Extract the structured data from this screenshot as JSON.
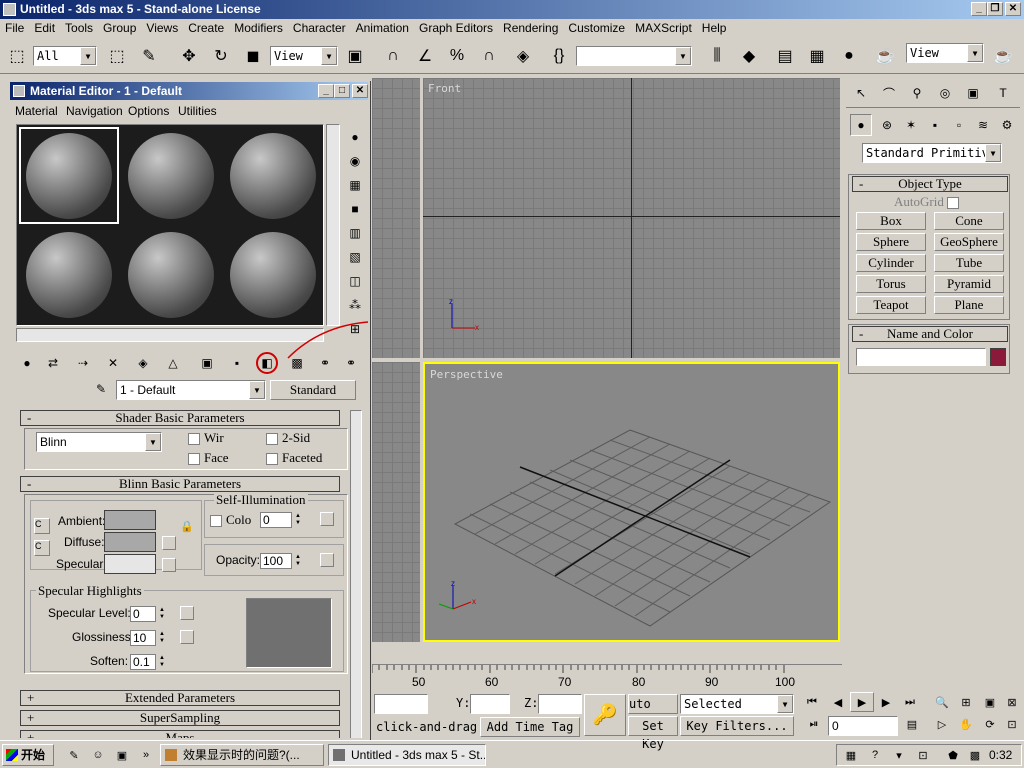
{
  "window": {
    "title": "Untitled - 3ds max 5 - Stand-alone License"
  },
  "menu": [
    "File",
    "Edit",
    "Tools",
    "Group",
    "Views",
    "Create",
    "Modifiers",
    "Character",
    "Animation",
    "Graph Editors",
    "Rendering",
    "Customize",
    "MAXScript",
    "Help"
  ],
  "toolbar": {
    "selection_filter": "All",
    "ref_coord": "View",
    "ref_coord2": "View"
  },
  "viewports": {
    "top_right": "Front",
    "bottom_right": "Perspective"
  },
  "material_editor": {
    "title": "Material Editor - 1 - Default",
    "menu": [
      "Material",
      "Navigation",
      "Options",
      "Utilities"
    ],
    "material_name": "1 - Default",
    "material_type": "Standard",
    "shader_rollout": "Shader Basic Parameters",
    "shader_type": "Blinn",
    "shader_options": {
      "wire": "Wir",
      "two_sided": "2-Sid",
      "face": "Face",
      "faceted": "Faceted"
    },
    "blinn_rollout": "Blinn Basic Parameters",
    "self_illum": {
      "title": "Self-Illumination",
      "color_label": "Colo",
      "value": "0"
    },
    "ambient_label": "Ambient:",
    "diffuse_label": "Diffuse:",
    "specular_label": "Specular:",
    "opacity_label": "Opacity:",
    "opacity_value": "100",
    "specular_highlights": {
      "title": "Specular Highlights",
      "level_label": "Specular Level:",
      "level": "0",
      "gloss_label": "Glossiness:",
      "gloss": "10",
      "soften_label": "Soften:",
      "soften": "0.1"
    },
    "rollouts_collapsed": [
      "Extended Parameters",
      "SuperSampling",
      "Maps"
    ]
  },
  "command_panel": {
    "category": "Standard Primitiv",
    "object_type_title": "Object Type",
    "autogrid": "AutoGrid",
    "buttons": [
      "Box",
      "Cone",
      "Sphere",
      "GeoSphere",
      "Cylinder",
      "Tube",
      "Torus",
      "Pyramid",
      "Teapot",
      "Plane"
    ],
    "name_color_title": "Name and Color"
  },
  "timeline": {
    "ticks": [
      "50",
      "60",
      "70",
      "80",
      "90",
      "100"
    ]
  },
  "status": {
    "y_label": "Y:",
    "z_label": "Z:",
    "prompt": "click-and-drag",
    "add_time_tag": "Add Time Tag",
    "auto_key": "uto Key",
    "set_key": "Set Key",
    "selected": "Selected",
    "key_filters": "Key Filters...",
    "frame": "0"
  },
  "taskbar": {
    "start": "开始",
    "task1": "效果显示时的问题?(...",
    "task2": "Untitled - 3ds max 5 - St...",
    "clock": "0:32"
  },
  "colors": {
    "title_active": "#0a246a",
    "name_swatch": "#8b1a3a",
    "perspective_border": "#ffff00"
  }
}
